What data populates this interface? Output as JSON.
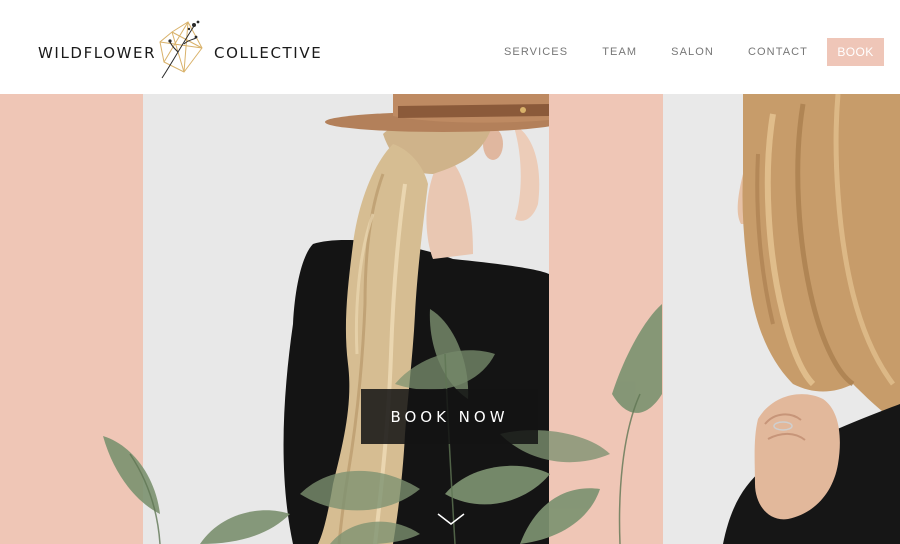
{
  "brand": {
    "name_left": "WILDFLOWER",
    "name_right": "COLLECTIVE",
    "logo_icon": "geometric-terrarium-flower-icon"
  },
  "nav": {
    "items": [
      {
        "label": "SERVICES"
      },
      {
        "label": "TEAM"
      },
      {
        "label": "SALON"
      },
      {
        "label": "CONTACT"
      }
    ],
    "book_label": "BOOK"
  },
  "hero": {
    "cta_label": "BOOK NOW",
    "scroll_icon": "chevron-down-icon"
  },
  "colors": {
    "accent_pink": "#efc6b8",
    "text_dark": "#1a1a1a",
    "nav_gray": "#777777",
    "photo_bg": "#e8e8e8",
    "leaf_green": "#7d9271"
  }
}
